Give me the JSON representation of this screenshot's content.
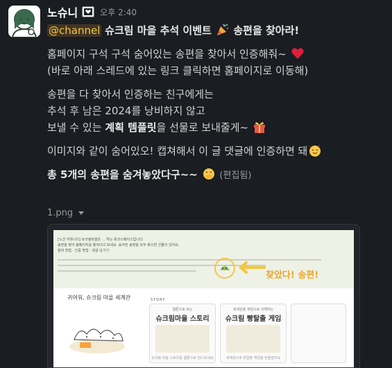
{
  "message": {
    "author": "노슈니",
    "time": "오후 2:40",
    "mention": "@channel",
    "title_text": "슈크림 마을 추석 이벤트",
    "title_tail": "송편을 찾아라!",
    "para2_line1": "홈페이지 구석 구석 숨어있는 송편을 찾아서 인증해줘~",
    "para2_line2": "(바로 아래 스레드에 있는 링크 클릭하면 홈페이지로 이동해)",
    "para3_line1": "송편을 다 찾아서 인증하는 친구에게는",
    "para3_line2": "추석 후 남은 2024를 낭비하지 않고",
    "para3_line3_pre": "보낼 수 있는",
    "para3_line3_bold": "계획 템플릿",
    "para3_line3_post": "을 선물로 보내줄게~",
    "para4": "이미지와 같이 숨어있오! 캡쳐해서 이 글 댓글에 인증하면 돼",
    "para5_bold": "총 5개의 송편을 숨겨놓았다구~~",
    "edited": "(편집됨)"
  },
  "attachment": {
    "filename": "1.png",
    "banner_lines": [
      "[노션 커뮤니티] 슈크림마을은 ... 하는 워크스페이스입니다.",
      "송편을 찾아 홈페이지를 돌아다녀 보세요. 숨겨진 송편을 모두 찾으면 선물이 있어요.",
      "참여 방법 · 인증 방법 · 댓글 남기기"
    ],
    "found_label": "찾았다! 송편!",
    "left_title": "귀여워, 슈크림 마을 세계관",
    "story_tag": "STORY",
    "cards": [
      {
        "small": "웹툰으로 보는",
        "title": "슈크림마을 스토리",
        "foot": "슈크림 마을 스토리를 웹툰으로 만나보세요"
      },
      {
        "small": "세계관을 게임으로 이해하는",
        "title": "슈크림 빵탈출 게임",
        "foot": "세계관으로 방탈출 게임을 만들었어요"
      },
      {
        "small": "",
        "title": "",
        "foot": ""
      }
    ]
  }
}
